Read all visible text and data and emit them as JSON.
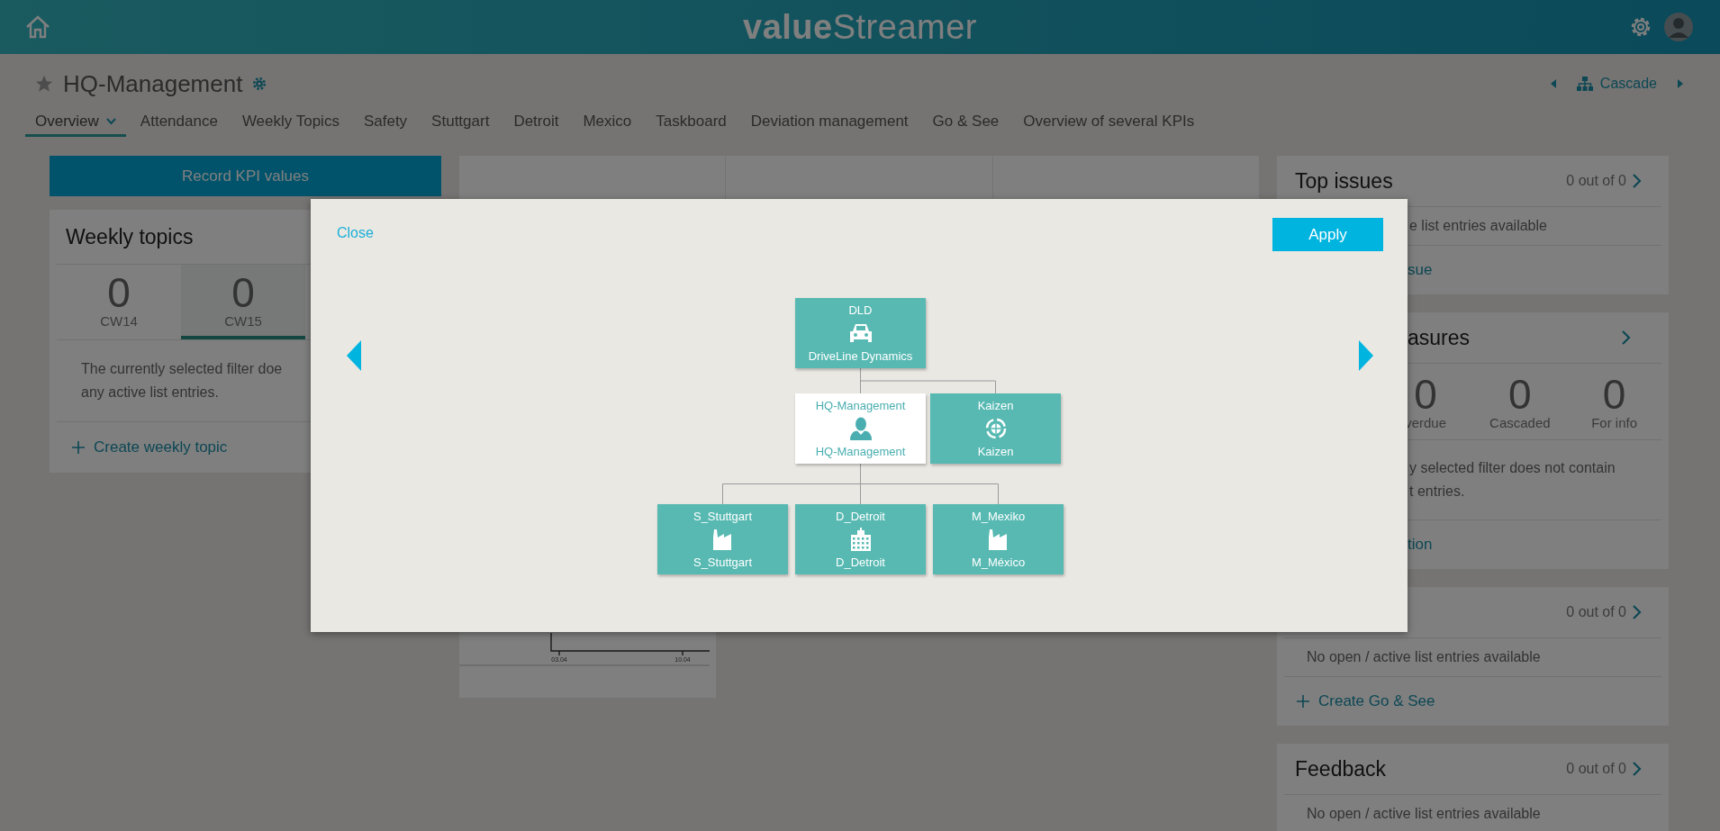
{
  "header": {
    "logo": "**value**Streamer"
  },
  "page": {
    "title": "HQ-Management",
    "starred": false,
    "nav_label": "Cascade"
  },
  "tabs": [
    {
      "label": "Overview",
      "selected": true
    },
    {
      "label": "Attendance",
      "selected": false
    },
    {
      "label": "Weekly Topics",
      "selected": false
    },
    {
      "label": "Safety",
      "selected": false
    },
    {
      "label": "Stuttgart",
      "selected": false
    },
    {
      "label": "Detroit",
      "selected": false
    },
    {
      "label": "Mexico",
      "selected": false
    },
    {
      "label": "Taskboard",
      "selected": false
    },
    {
      "label": "Deviation management",
      "selected": false
    },
    {
      "label": "Go & See",
      "selected": false
    },
    {
      "label": "Overview of several KPIs",
      "selected": false
    }
  ],
  "left": {
    "record_button": "Record KPI values",
    "weekly_topics": {
      "title": "Weekly topics",
      "weeks": [
        {
          "count": "0",
          "label": "CW14",
          "selected": false
        },
        {
          "count": "0",
          "label": "CW15",
          "selected": true
        }
      ],
      "message_lines": [
        "The currently selected filter doe",
        "any active list entries."
      ],
      "create_link": "Create weekly topic"
    }
  },
  "center": {
    "chart_ticks": [
      "03.04",
      "10.04"
    ]
  },
  "right_cards": [
    {
      "title": "Top issues",
      "count": "0 out of 0",
      "message_lines": [
        "e list entries available"
      ],
      "link": "sue"
    },
    {
      "title": "asures",
      "counters": [
        {
          "count": "0",
          "label": "verdue"
        },
        {
          "count": "0",
          "label": "Cascaded"
        },
        {
          "count": "0",
          "label": "For info"
        }
      ],
      "message_lines": [
        "y selected filter does not contain",
        "t entries."
      ],
      "link": "tion"
    },
    {
      "count": "0 out of 0",
      "message_lines": [
        "No open / active list entries available"
      ],
      "link": "Create Go & See"
    },
    {
      "title": "Feedback",
      "count": "0 out of 0",
      "message_lines": [
        "No open / active list entries available"
      ]
    }
  ],
  "modal": {
    "close": "Close",
    "apply": "Apply",
    "tree": {
      "top": "DLD",
      "bottom": "DriveLine Dynamics",
      "kind": "car",
      "selected": false,
      "children": [
        {
          "top": "HQ-Management",
          "bottom": "HQ-Management",
          "kind": "person",
          "selected": true,
          "children": [
            {
              "top": "S_Stuttgart",
              "bottom": "S_Stuttgart",
              "kind": "factory",
              "selected": false
            },
            {
              "top": "D_Detroit",
              "bottom": "D_Detroit",
              "kind": "building",
              "selected": false
            },
            {
              "top": "M_Mexiko",
              "bottom": "M_México",
              "kind": "factory",
              "selected": false
            }
          ]
        },
        {
          "top": "Kaizen",
          "bottom": "Kaizen",
          "kind": "cycle",
          "selected": false
        }
      ]
    }
  }
}
